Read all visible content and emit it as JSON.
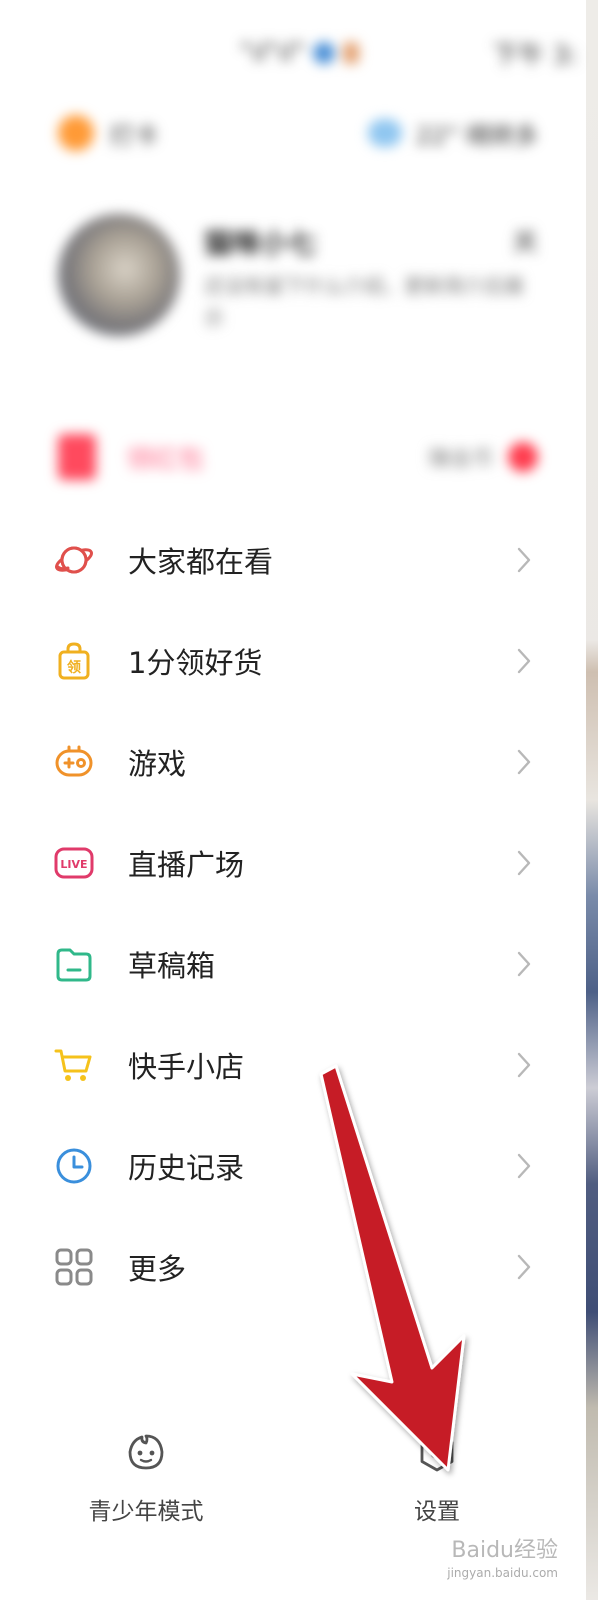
{
  "status_bar": {
    "signal": "\"ıl\"ıl\"",
    "time": "下午 3:"
  },
  "top_row": {
    "left_label": "打卡",
    "right_label": "22°  晴转多"
  },
  "profile": {
    "name": "猫咪小七",
    "count": "关",
    "bio": "还没有留下什么介绍，更新简介后展示"
  },
  "promo": {
    "label": "领红包",
    "right_label": "赚金币"
  },
  "menu": {
    "items": [
      {
        "label": "大家都在看",
        "icon": "planet-icon",
        "color": "#e0504c"
      },
      {
        "label": "1分领好货",
        "icon": "gift-bag-icon",
        "color": "#f0b020",
        "icon_text": "领"
      },
      {
        "label": "游戏",
        "icon": "gamepad-icon",
        "color": "#f0922a"
      },
      {
        "label": "直播广场",
        "icon": "live-icon",
        "color": "#e03a6a",
        "icon_text": "LIVE"
      },
      {
        "label": "草稿箱",
        "icon": "folder-icon",
        "color": "#30b88a"
      },
      {
        "label": "快手小店",
        "icon": "cart-icon",
        "color": "#f5c21b"
      },
      {
        "label": "历史记录",
        "icon": "clock-icon",
        "color": "#3a8fdc"
      },
      {
        "label": "更多",
        "icon": "grid-icon",
        "color": "#8a8a8a"
      }
    ]
  },
  "bottom": {
    "teen_label": "青少年模式",
    "settings_label": "设置"
  },
  "overlay": {
    "arrow_color": "#c61e26",
    "watermark": "Baidu经验",
    "watermark_sub": "jingyan.baidu.com"
  }
}
